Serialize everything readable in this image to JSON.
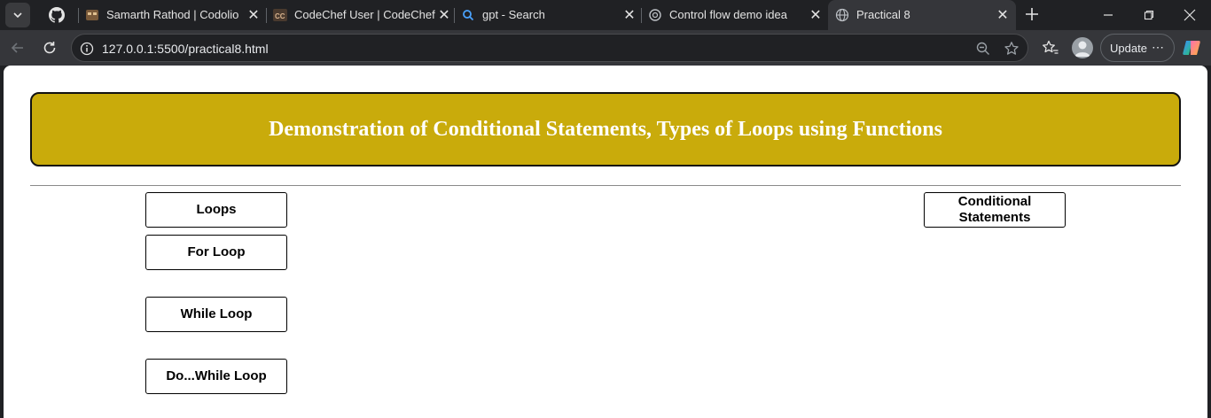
{
  "browser": {
    "tabs": [
      {
        "title": "Samarth Rathod | Codolio",
        "icon": "codolio-icon"
      },
      {
        "title": "CodeChef User | CodeChef",
        "icon": "codechef-icon"
      },
      {
        "title": "gpt - Search",
        "icon": "search-icon"
      },
      {
        "title": "Control flow demo idea",
        "icon": "chatgpt-icon"
      },
      {
        "title": "Practical 8",
        "icon": "globe-icon",
        "active": true
      }
    ],
    "url_host": "127.0.0.1",
    "url_rest": ":5500/practical8.html",
    "update_label": "Update",
    "more_label": "⋯"
  },
  "page": {
    "heading": "Demonstration of Conditional Statements, Types of Loops using Functions",
    "buttons": {
      "loops": "Loops",
      "for_loop": "For Loop",
      "while_loop": "While Loop",
      "do_while_loop": "Do...While Loop",
      "conditional_statements": "Conditional Statements"
    }
  },
  "colors": {
    "banner": "#c9ab0b",
    "banner_text": "#ffffff",
    "chrome_dark": "#202124",
    "chrome_toolbar": "#35363a"
  }
}
